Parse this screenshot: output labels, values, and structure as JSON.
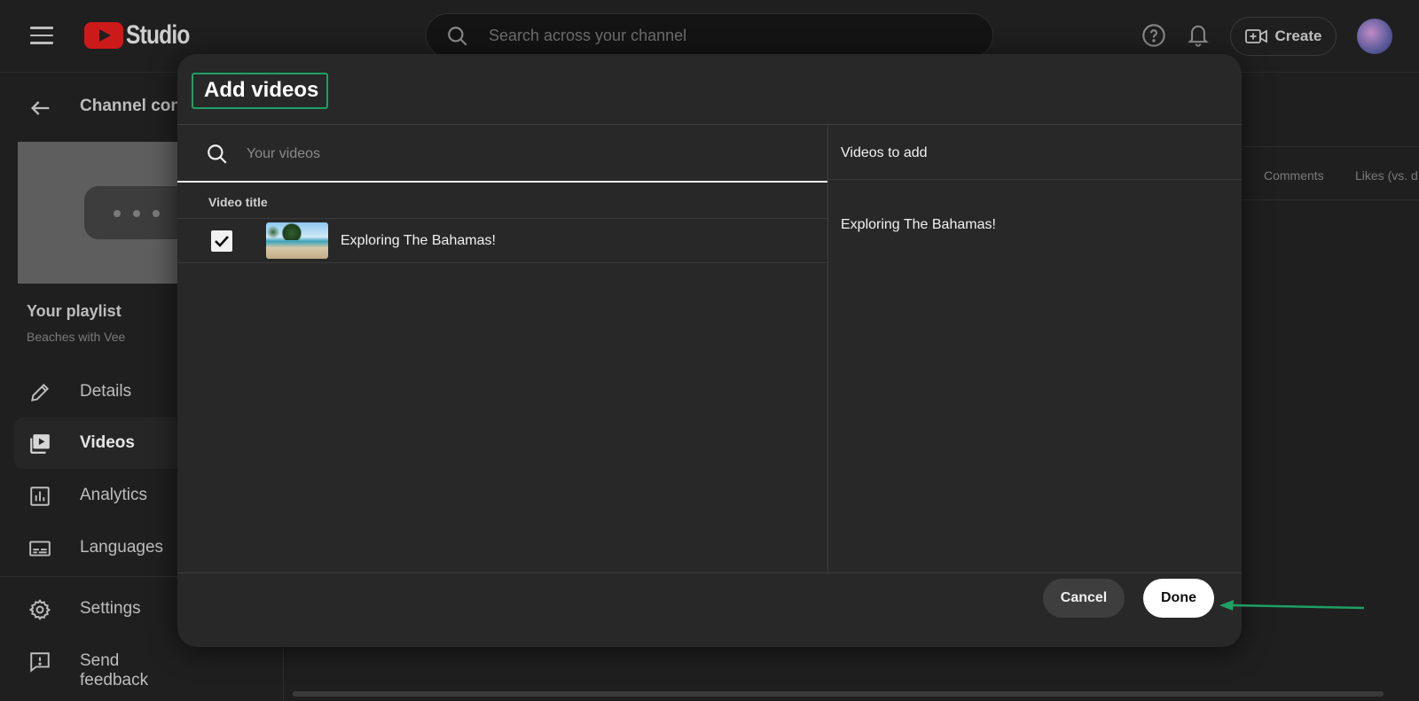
{
  "app": {
    "logo_text": "Studio",
    "search_placeholder": "Search across your channel",
    "create_label": "Create"
  },
  "sidebar": {
    "section_title": "Channel cont",
    "playlist_heading": "Your playlist",
    "playlist_name": "Beaches with Vee",
    "items": [
      {
        "label": "Details",
        "icon": "pencil-icon"
      },
      {
        "label": "Videos",
        "icon": "video-library-icon",
        "active": true
      },
      {
        "label": "Analytics",
        "icon": "analytics-icon"
      },
      {
        "label": "Languages",
        "icon": "subtitles-icon"
      },
      {
        "label": "Settings",
        "icon": "gear-icon"
      },
      {
        "label": "Send feedback",
        "icon": "feedback-icon"
      }
    ]
  },
  "background_table": {
    "columns": [
      "Comments",
      "Likes (vs. d"
    ]
  },
  "dialog": {
    "title": "Add videos",
    "search_placeholder": "Your videos",
    "table_header": "Video title",
    "videos": [
      {
        "title": "Exploring The Bahamas!",
        "checked": true
      }
    ],
    "right_panel_title": "Videos to add",
    "selected_videos": [
      "Exploring The Bahamas!"
    ],
    "cancel_label": "Cancel",
    "done_label": "Done"
  },
  "colors": {
    "highlight_box": "#1ea064",
    "annotation_arrow": "#1ea064",
    "youtube_red": "#cc1a1a"
  }
}
